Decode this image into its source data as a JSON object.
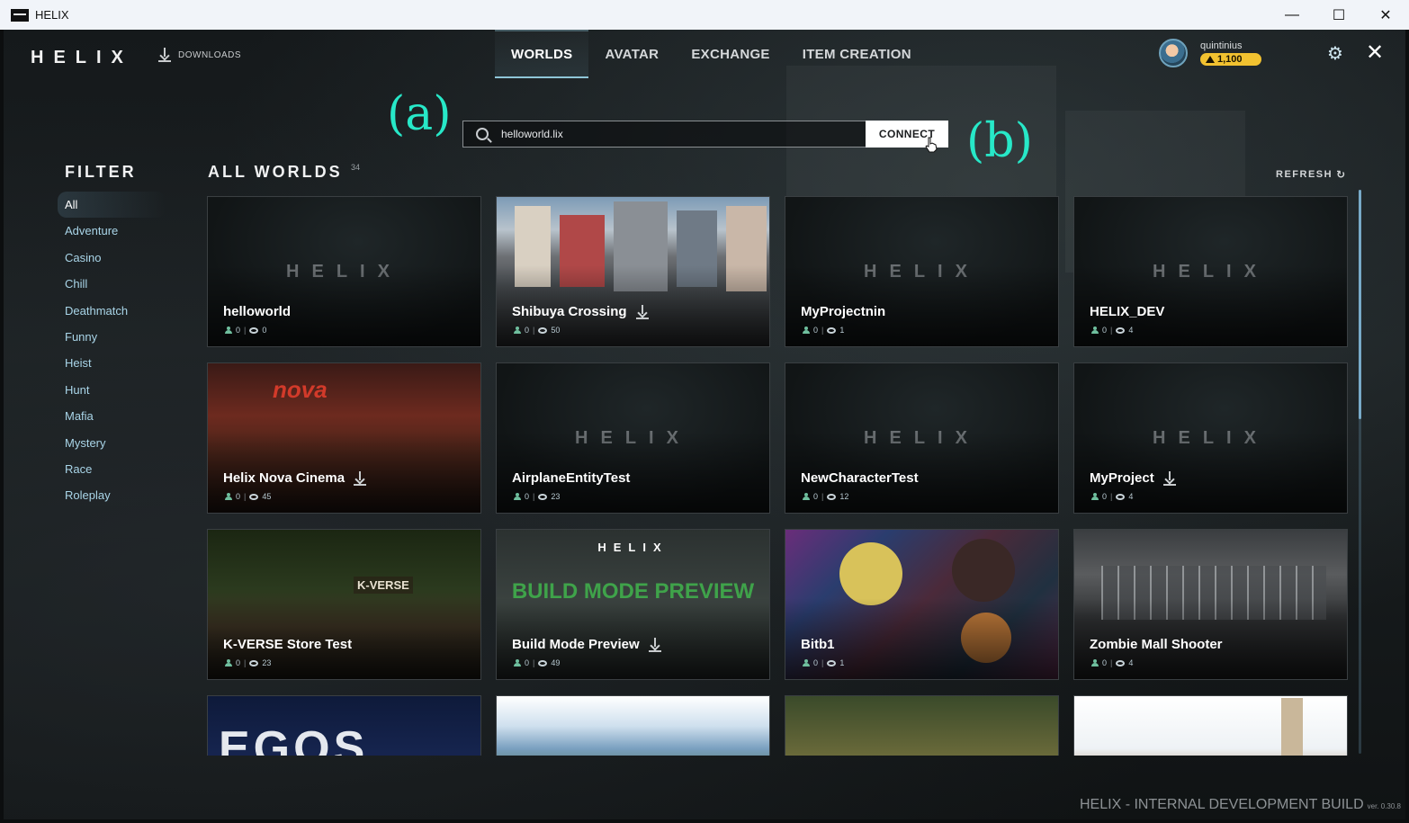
{
  "window": {
    "title": "HELIX",
    "minimize": "—",
    "maximize": "☐",
    "close": "✕"
  },
  "nav": {
    "logo": "HELIX",
    "downloads": "DOWNLOADS",
    "tabs": [
      {
        "label": "WORLDS",
        "active": true
      },
      {
        "label": "AVATAR",
        "active": false
      },
      {
        "label": "EXCHANGE",
        "active": false
      },
      {
        "label": "ITEM CREATION",
        "active": false
      }
    ],
    "user": {
      "name": "quintinius",
      "coins": "1,100"
    },
    "settings_icon": "gear-icon",
    "close_icon": "close-icon"
  },
  "annotations": {
    "a": "(a)",
    "b": "(b)"
  },
  "search": {
    "value": "helloworld.lix",
    "connect_label": "CONNECT"
  },
  "filter": {
    "title": "FILTER",
    "items": [
      "All",
      "Adventure",
      "Casino",
      "Chill",
      "Deathmatch",
      "Funny",
      "Heist",
      "Hunt",
      "Mafia",
      "Mystery",
      "Race",
      "Roleplay"
    ],
    "active": "All"
  },
  "worlds": {
    "title": "ALL WORLDS",
    "count": "34",
    "refresh": "REFRESH",
    "cards": [
      {
        "name": "helloworld",
        "players": "0",
        "views": "0",
        "thumb": "placeholder",
        "download": false
      },
      {
        "name": "Shibuya Crossing",
        "players": "0",
        "views": "50",
        "thumb": "city",
        "download": true
      },
      {
        "name": "MyProjectnin",
        "players": "0",
        "views": "1",
        "thumb": "placeholder",
        "download": false
      },
      {
        "name": "HELIX_DEV",
        "players": "0",
        "views": "4",
        "thumb": "placeholder",
        "download": false
      },
      {
        "name": "Helix Nova Cinema",
        "players": "0",
        "views": "45",
        "thumb": "cinema",
        "download": true
      },
      {
        "name": "AirplaneEntityTest",
        "players": "0",
        "views": "23",
        "thumb": "placeholder",
        "download": false
      },
      {
        "name": "NewCharacterTest",
        "players": "0",
        "views": "12",
        "thumb": "placeholder",
        "download": false
      },
      {
        "name": "MyProject",
        "players": "0",
        "views": "4",
        "thumb": "placeholder",
        "download": true
      },
      {
        "name": "K-VERSE Store Test",
        "players": "0",
        "views": "23",
        "thumb": "kverse",
        "download": false
      },
      {
        "name": "Build Mode Preview",
        "players": "0",
        "views": "49",
        "thumb": "build",
        "download": true
      },
      {
        "name": "Bitb1",
        "players": "0",
        "views": "1",
        "thumb": "bitb",
        "download": false
      },
      {
        "name": "Zombie Mall Shooter",
        "players": "0",
        "views": "4",
        "thumb": "mall",
        "download": false
      },
      {
        "name": "",
        "players": "",
        "views": "",
        "thumb": "egos",
        "download": false
      },
      {
        "name": "",
        "players": "",
        "views": "",
        "thumb": "land",
        "download": false
      },
      {
        "name": "",
        "players": "",
        "views": "",
        "thumb": "ruin",
        "download": false
      },
      {
        "name": "",
        "players": "",
        "views": "",
        "thumb": "town",
        "download": false
      }
    ],
    "thumb_text": {
      "placeholder": "HELIX",
      "cinema": "nova",
      "kverse": "K-VERSE",
      "build_logo": "HELIX",
      "build_text": "BUILD MODE PREVIEW",
      "egos": "EGOS"
    }
  },
  "footer": {
    "text": "HELIX - INTERNAL DEVELOPMENT BUILD",
    "version": "ver. 0.30.8"
  }
}
